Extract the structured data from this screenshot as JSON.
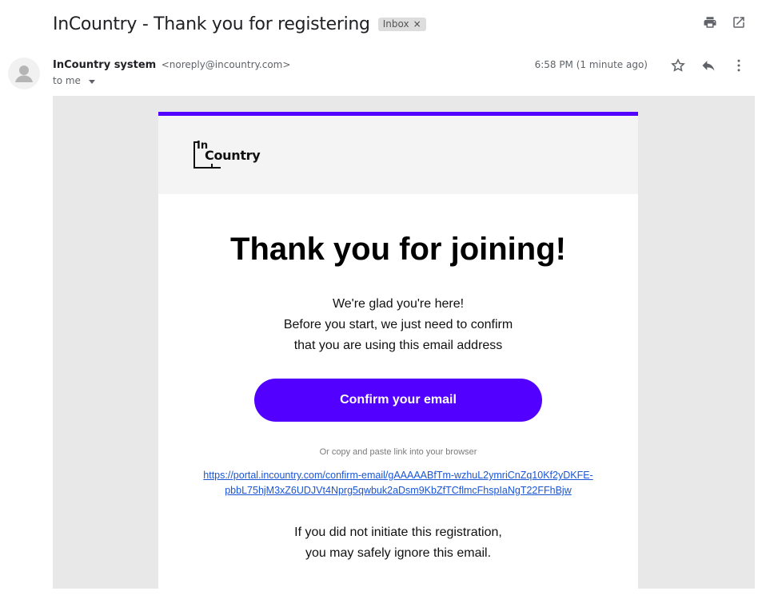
{
  "email": {
    "subject": "InCountry - Thank you for registering",
    "label": "Inbox",
    "label_close": "×",
    "sender_name": "InCountry system",
    "sender_email": "<noreply@incountry.com>",
    "to": "to me",
    "time": "6:58 PM (1 minute ago)"
  },
  "icons": {
    "print": "printer-icon",
    "open_new_window": "open-in-new-window-icon",
    "star": "star-icon",
    "reply": "reply-icon",
    "more": "more-vertical-icon",
    "avatar": "person-icon"
  },
  "content": {
    "logo_in": "In",
    "logo_country": "Country",
    "heading": "Thank you for joining!",
    "body_line1": "We're glad you're here!",
    "body_line2": "Before you start, we just need to confirm",
    "body_line3": "that you are using this email address",
    "cta_label": "Confirm your email",
    "copy_note": "Or copy and paste link into your browser",
    "link_line1": "https://portal.incountry.com/confirm-email/gAAAAABfTm-wzhuL2ymriCnZq10Kf2yDKFE-",
    "link_line2": "pbbL75hjM3xZ6UDJVt4Nprg5qwbuk2aDsm9KbZfTCflmcFhspIaNgT22FFhBjw",
    "footer_line1": "If you did not initiate this registration,",
    "footer_line2": "you may safely ignore this email."
  },
  "colors": {
    "brand_purple": "#5200ff",
    "link_blue": "#1a55d6",
    "email_bg": "#e8e8e8",
    "header_bg": "#f4f4f4"
  }
}
